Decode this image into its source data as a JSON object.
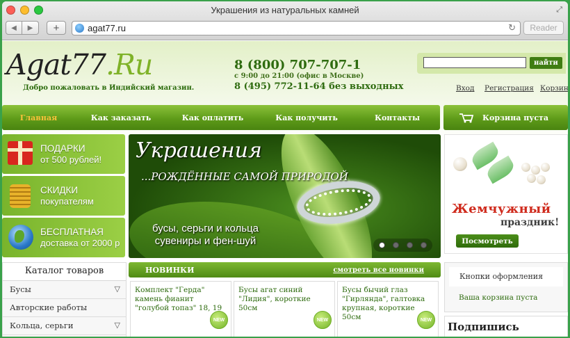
{
  "browser": {
    "title": "Украшения из натуральных камней",
    "url": "agat77.ru",
    "reader": "Reader"
  },
  "header": {
    "logo_main": "Agat77",
    "logo_accent": ".Ru",
    "welcome": "Добро пожаловать в Индийский магазин.",
    "phone1": "8 (800) 707-707-1",
    "hours": "с 9:00 до 21:00 (офис в Москве)",
    "phone2": "8 (495) 772-11-64 без выходных",
    "search_button": "найти",
    "login": "Вход",
    "register": "Регистрация",
    "cart": "Корзина"
  },
  "nav": {
    "items": [
      "Главная",
      "Как заказать",
      "Как оплатить",
      "Как получить",
      "Контакты"
    ],
    "cart_status": "Корзина пуста"
  },
  "promos": [
    {
      "line1": "ПОДАРКИ",
      "line2": "от 500 рублей!"
    },
    {
      "line1": "СКИДКИ",
      "line2": "покупателям"
    },
    {
      "line1": "БЕСПЛАТНАЯ",
      "line2": "доставка от 2000 р"
    }
  ],
  "banner": {
    "title": "Украшения",
    "subtitle": "...РОЖДЁННЫЕ САМОЙ ПРИРОДОЙ",
    "line1": "бусы, серьги и кольца",
    "line2": "сувениры и фен-шуй"
  },
  "side_promo": {
    "title": "Жемчужный",
    "subtitle": "праздник!",
    "button": "Посмотреть"
  },
  "catalog": {
    "title": "Каталог товаров",
    "items": [
      "Бусы",
      "Авторские работы",
      "Кольца, серьги"
    ]
  },
  "news": {
    "title": "НОВИНКИ",
    "see_all": "смотреть все новинки",
    "badge": "NEW",
    "cards": [
      {
        "title": "Комплект \"Герда\" камень фианит \"голубой топаз\" 18, 19"
      },
      {
        "title": "Бусы агат синий \"Лидия\", короткие 50см"
      },
      {
        "title": "Бусы бычий глаз \"Гирлянда\", галтовка крупная, короткие 50см"
      }
    ]
  },
  "right": {
    "buttons_link": "Кнопки оформления",
    "cart_link": "Ваша корзина пуста",
    "subscribe": "Подпишись"
  }
}
